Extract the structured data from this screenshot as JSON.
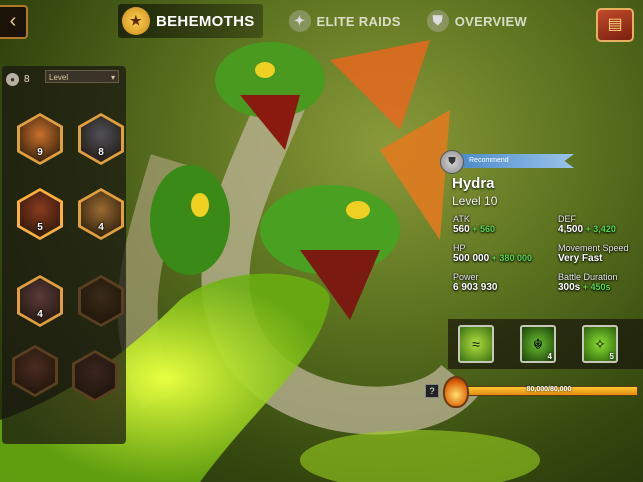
{
  "nav": {
    "back_icon": "‹",
    "tabs": [
      {
        "label": "BEHEMOTHS",
        "icon": "behemoth-crest-icon",
        "active": true
      },
      {
        "label": "ELITE RAIDS",
        "icon": "elite-raids-icon",
        "active": false
      },
      {
        "label": "OVERVIEW",
        "icon": "overview-shield-icon",
        "active": false
      }
    ],
    "book_icon": "spellbook-icon"
  },
  "panel": {
    "pet_count": "8",
    "level_select": "Level",
    "behemoths": [
      {
        "level": "9",
        "name": "bear",
        "color": "#c8702a",
        "border": "#e0a040"
      },
      {
        "level": "8",
        "name": "gorilla",
        "color": "#505058",
        "border": "#e0a040"
      },
      {
        "level": "5",
        "name": "hydra",
        "color": "#8a3a20",
        "border": "#ffb040",
        "selected": true
      },
      {
        "level": "4",
        "name": "griffin",
        "color": "#9a6a30",
        "border": "#e0a040"
      },
      {
        "level": "4",
        "name": "demon-ape",
        "color": "#5a3a3a",
        "border": "#e0a040"
      },
      {
        "level": "",
        "name": "lion-locked",
        "color": "#3a2a18",
        "border": "#5a4020"
      },
      {
        "level": "",
        "name": "dragon-locked",
        "color": "#4a2a20",
        "border": "#5a4020"
      },
      {
        "level": "",
        "name": "boar-locked",
        "color": "#3a2420",
        "border": "#5a4020"
      }
    ]
  },
  "recommend_label": "Recommend",
  "boss": {
    "name": "Hydra",
    "level": "Level 10",
    "stats": {
      "atk_label": "ATK",
      "atk_value": "560",
      "atk_bonus": "+ 560",
      "def_label": "DEF",
      "def_value": "4,500",
      "def_bonus": "+ 3,420",
      "hp_label": "HP",
      "hp_value": "500 000",
      "hp_bonus": "+ 380 000",
      "move_label": "Movement Speed",
      "move_value": "Very Fast",
      "power_label": "Power",
      "power_value": "6 903 930",
      "battle_label": "Battle Duration",
      "battle_value": "300s",
      "battle_bonus": "+ 450s"
    }
  },
  "skills": [
    {
      "icon": "acid-pool-icon",
      "num": ""
    },
    {
      "icon": "hydra-bite-icon",
      "num": "4"
    },
    {
      "icon": "poison-split-icon",
      "num": "5"
    }
  ],
  "help_label": "?",
  "hp_bar": {
    "text": "80,000/80,000",
    "fill": 1.0
  }
}
